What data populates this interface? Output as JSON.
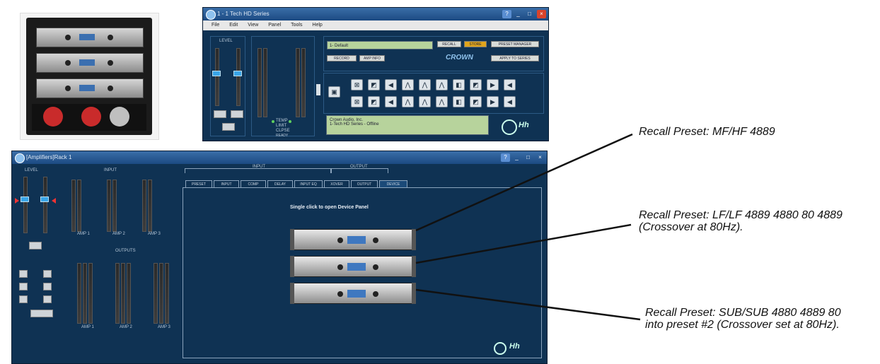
{
  "top_window": {
    "title": "1 - 1 Tech HD Series",
    "menu": [
      "File",
      "Edit",
      "View",
      "Panel",
      "Tools",
      "Help"
    ],
    "preset_name": "1- Default",
    "buttons": [
      "RECALL",
      "STORE",
      "PRESET MANAGER",
      "RECORD",
      "AMP INFO",
      "APPLY TO SERIES"
    ],
    "brand": "CROWN",
    "lcd_lines": [
      "Crown Audio, Inc.",
      "1-Tech HD Series - Offline"
    ],
    "status_labels": [
      "TEMP",
      "LIMIT",
      "CLPSE",
      "READY"
    ]
  },
  "bottom_window": {
    "title": "[Amplifiers]Rack 1",
    "level_label": "LEVEL",
    "inputs_label": "INPUT",
    "outputs_label": "OUTPUTS",
    "input_group_label": "INPUT",
    "output_group_label": "OUTPUT",
    "tabs": [
      "PRESET",
      "INPUT",
      "COMP",
      "DELAY",
      "INPUT EQ",
      "XOVER",
      "OUTPUT",
      "DEVICE"
    ],
    "hint": "Single click to open Device Panel",
    "amp_labels": [
      "AMP 1",
      "AMP 2",
      "AMP 3"
    ]
  },
  "callouts": [
    {
      "text": "Recall Preset: MF/HF 4889"
    },
    {
      "text": "Recall Preset: LF/LF 4889 4880 80 4889\n(Crossover at 80Hz)."
    },
    {
      "text": "Recall Preset: SUB/SUB 4880 4889 80\ninto preset #2 (Crossover set at 80Hz)."
    }
  ],
  "colors": {
    "window_bg": "#0f3253",
    "fader": "#39a5e8",
    "lcd": "#b7d39c",
    "store": "#e0a51c"
  }
}
